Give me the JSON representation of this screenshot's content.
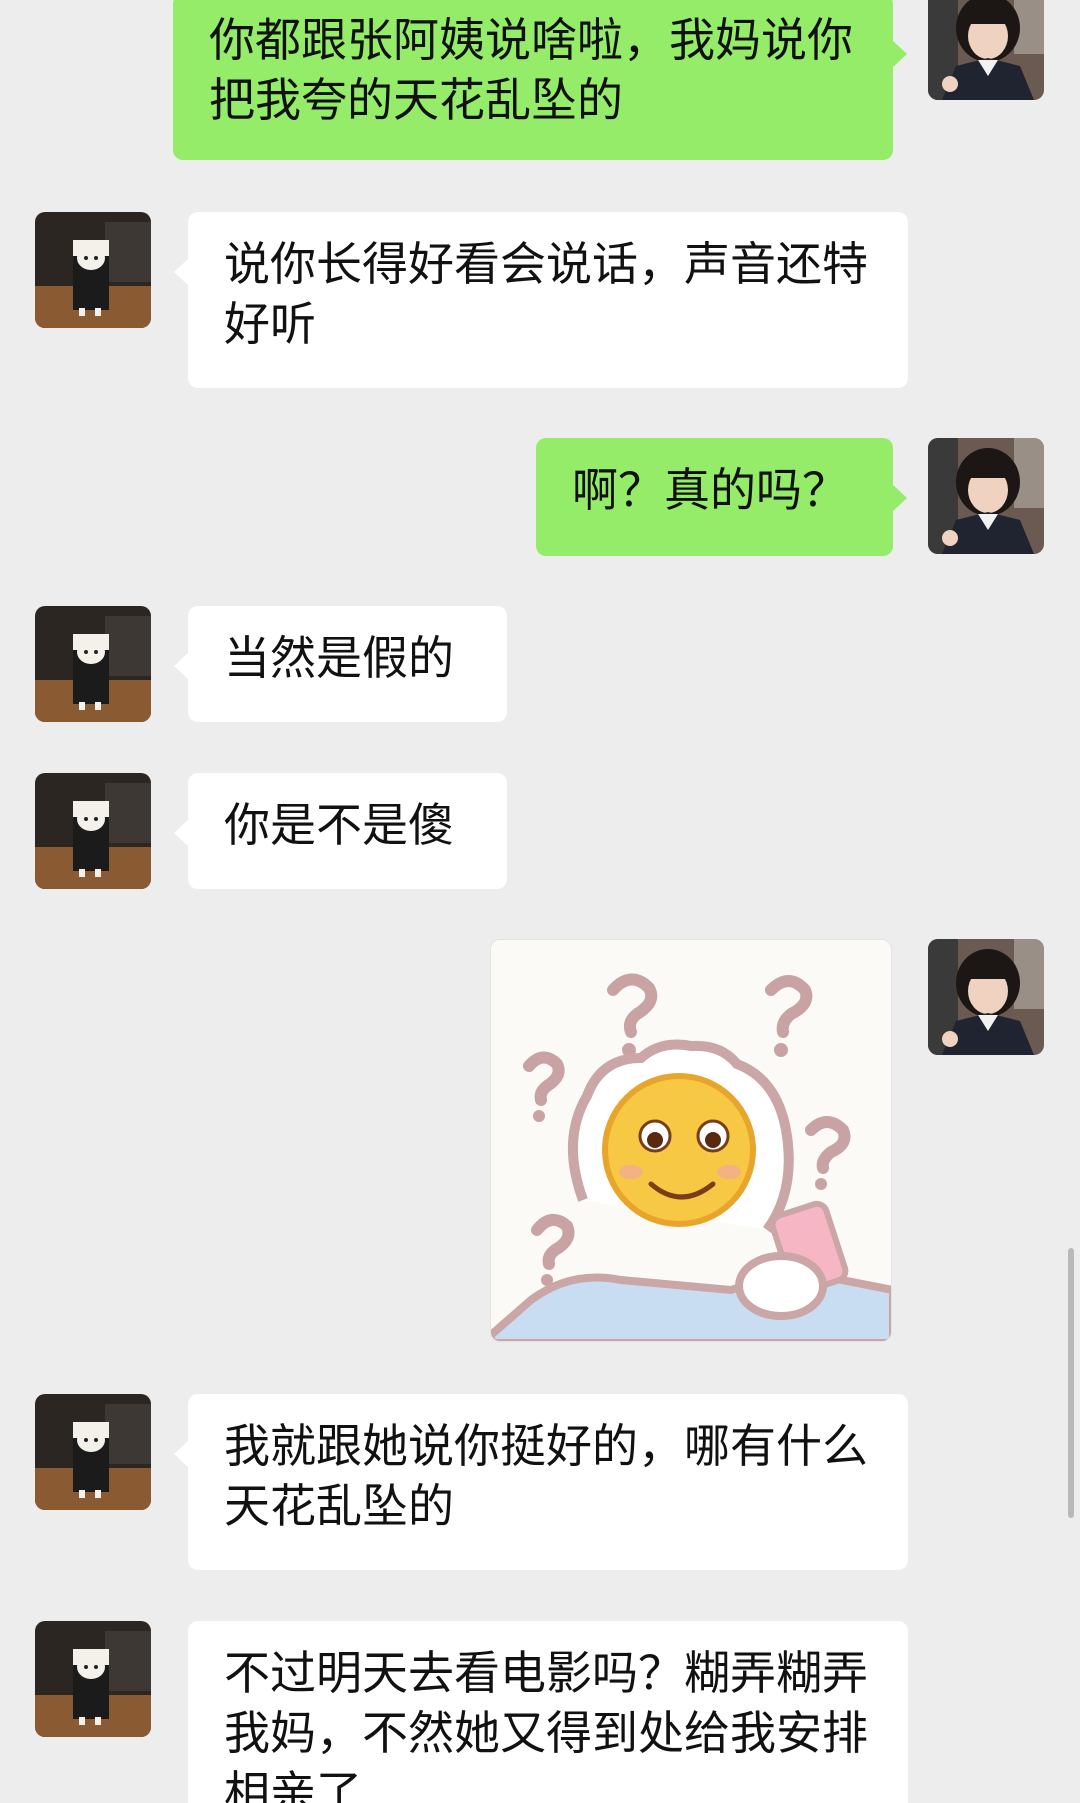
{
  "messages": [
    {
      "from": "me",
      "type": "text",
      "text": "你都跟张阿姨说啥啦，我妈说你把我夸的天花乱坠的"
    },
    {
      "from": "friend",
      "type": "text",
      "text": "说你长得好看会说话，声音还特好听"
    },
    {
      "from": "me",
      "type": "text",
      "text": "啊？真的吗？"
    },
    {
      "from": "friend",
      "type": "text",
      "text": "当然是假的"
    },
    {
      "from": "friend",
      "type": "text",
      "text": "你是不是傻"
    },
    {
      "from": "me",
      "type": "sticker",
      "sticker": "confused-smiley-question-marks"
    },
    {
      "from": "friend",
      "type": "text",
      "text": "我就跟她说你挺好的，哪有什么天花乱坠的"
    },
    {
      "from": "friend",
      "type": "text",
      "text": "不过明天去看电影吗？糊弄糊弄我妈，不然她又得到处给我安排相亲了"
    }
  ],
  "colors": {
    "background": "#ededed",
    "outgoing_bubble": "#95ec69",
    "incoming_bubble": "#ffffff"
  }
}
